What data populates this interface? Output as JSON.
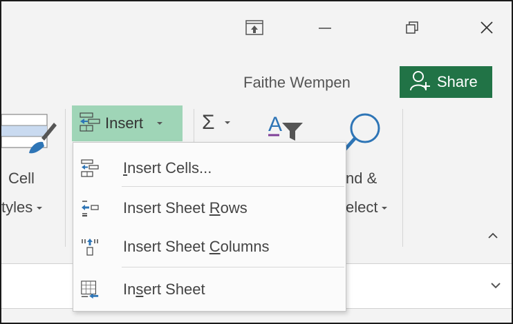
{
  "window": {
    "restore_ribbon_icon": "ribbon-display-icon",
    "minimize_icon": "minimize-icon",
    "restore_icon": "restore-icon",
    "close_icon": "close-icon"
  },
  "account": {
    "user_name": "Faithe Wempen",
    "share_label": "Share"
  },
  "ribbon": {
    "cell_styles_line1": "Cell",
    "cell_styles_line2": "tyles",
    "insert_label": "Insert",
    "find_select_line1": "nd &",
    "find_select_line2": "elect",
    "sum_symbol": "Σ"
  },
  "insert_menu": {
    "items": [
      {
        "label_pre": "",
        "accel": "I",
        "label_post": "nsert Cells...",
        "icon": "insert-cells-icon"
      },
      {
        "label_pre": "Insert Sheet ",
        "accel": "R",
        "label_post": "ows",
        "icon": "insert-rows-icon"
      },
      {
        "label_pre": "Insert Sheet ",
        "accel": "C",
        "label_post": "olumns",
        "icon": "insert-columns-icon"
      },
      {
        "label_pre": "In",
        "accel": "s",
        "label_post": "ert Sheet",
        "icon": "insert-sheet-icon"
      }
    ]
  },
  "colors": {
    "accent_green": "#217346",
    "insert_highlight": "#9fd5b7"
  }
}
